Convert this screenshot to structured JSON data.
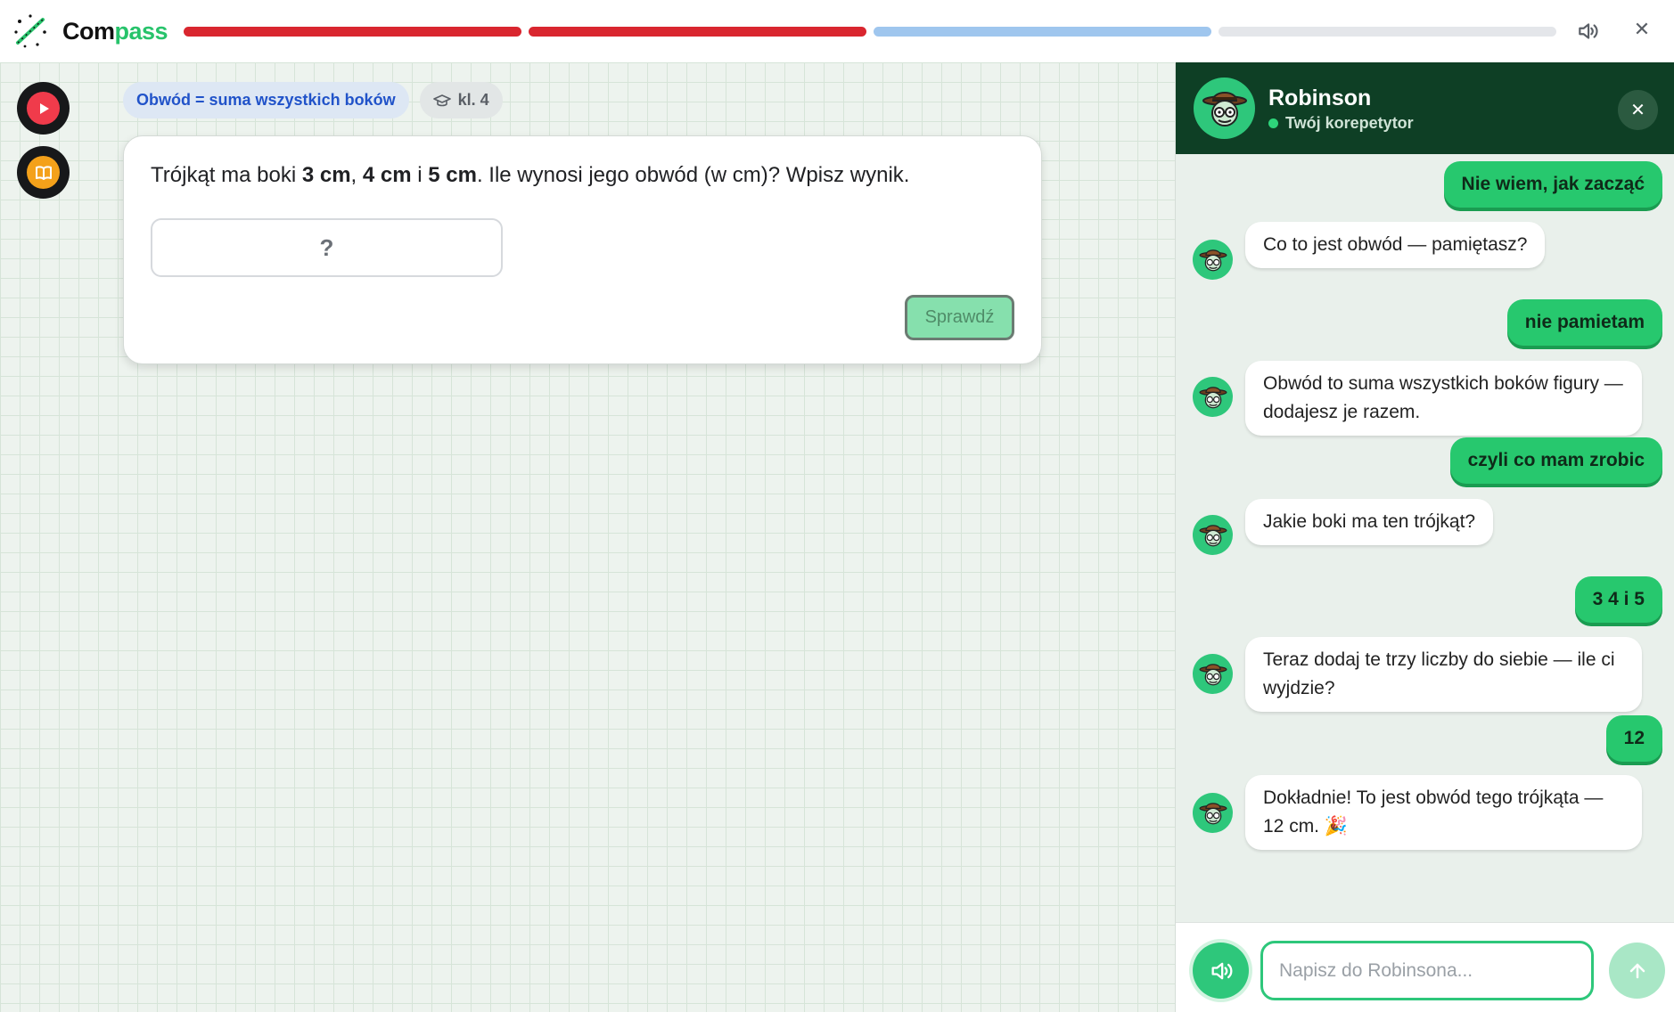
{
  "app": {
    "logo_part1": "Com",
    "logo_part2": "pass",
    "brand_color": "#27c36b"
  },
  "progress": {
    "segments": [
      {
        "state": "wrong",
        "color": "#d9262f"
      },
      {
        "state": "wrong",
        "color": "#d9262f"
      },
      {
        "state": "current",
        "color": "#9fc6ee"
      },
      {
        "state": "pending",
        "color": "#e4e6ea"
      }
    ]
  },
  "topbar": {
    "sound_icon": "speaker-icon",
    "close_glyph": "✕"
  },
  "sidebar": {
    "play_icon": "play-icon",
    "book_icon": "book-icon"
  },
  "task": {
    "topic_chip": "Obwód = suma wszystkich boków",
    "grade_chip": "kl. 4",
    "question": {
      "part1": "Trójkąt ma boki ",
      "side_a": "3 cm",
      "sep1": ", ",
      "side_b": "4 cm",
      "sep2": " i ",
      "side_c": "5 cm",
      "part2": ". Ile wynosi jego obwód (w cm)? Wpisz wynik."
    },
    "answer_placeholder": "?",
    "check_label": "Sprawdź"
  },
  "chat": {
    "tutor_name": "Robinson",
    "tutor_role": "Twój korepetytor",
    "close_glyph": "✕",
    "messages": [
      {
        "from": "user",
        "text": "Nie wiem, jak zacząć"
      },
      {
        "from": "bot",
        "text": "Co to jest obwód — pamiętasz?"
      },
      {
        "from": "user",
        "text": "nie pamietam"
      },
      {
        "from": "bot",
        "text": "Obwód to suma wszystkich boków figury — dodajesz je razem."
      },
      {
        "from": "user",
        "text": "czyli co mam zrobic"
      },
      {
        "from": "bot",
        "text": "Jakie boki ma ten trójkąt?"
      },
      {
        "from": "user",
        "text": "3 4 i 5"
      },
      {
        "from": "bot",
        "text": "Teraz dodaj te trzy liczby do siebie — ile ci wyjdzie?"
      },
      {
        "from": "user",
        "text": "12"
      },
      {
        "from": "bot",
        "text": "Dokładnie! To jest obwód tego trójkąta — 12 cm. 🎉"
      }
    ],
    "input_placeholder": "Napisz do Robinsona...",
    "input_value": ""
  }
}
